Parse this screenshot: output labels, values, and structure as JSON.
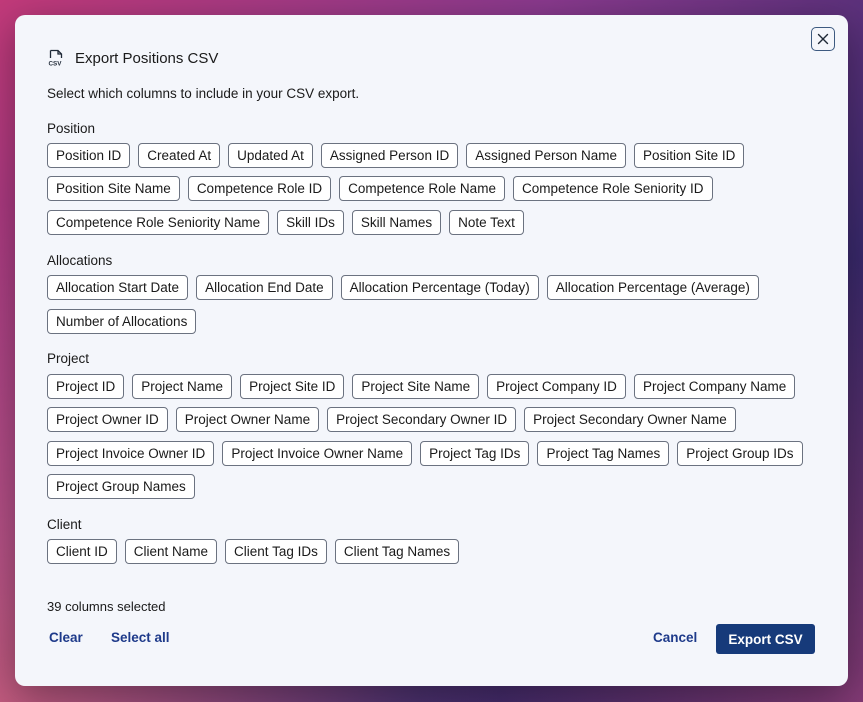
{
  "dialog": {
    "title": "Export Positions CSV",
    "description": "Select which columns to include in your CSV export.",
    "icon": "csv-file-icon",
    "selected_count_text": "39 columns selected",
    "clear_label": "Clear",
    "select_all_label": "Select all",
    "cancel_label": "Cancel",
    "export_label": "Export CSV"
  },
  "sections": [
    {
      "label": "Position",
      "rows": [
        [
          "Position ID",
          "Created At",
          "Updated At",
          "Assigned Person ID",
          "Assigned Person Name",
          "Position Site ID"
        ],
        [
          "Position Site Name",
          "Competence Role ID",
          "Competence Role Name",
          "Competence Role Seniority ID"
        ],
        [
          "Competence Role Seniority Name",
          "Skill IDs",
          "Skill Names",
          "Note Text"
        ]
      ]
    },
    {
      "label": "Allocations",
      "rows": [
        [
          "Allocation Start Date",
          "Allocation End Date",
          "Allocation Percentage (Today)",
          "Allocation Percentage (Average)"
        ],
        [
          "Number of Allocations"
        ]
      ]
    },
    {
      "label": "Project",
      "rows": [
        [
          "Project ID",
          "Project Name",
          "Project Site ID",
          "Project Site Name",
          "Project Company ID",
          "Project Company Name"
        ],
        [
          "Project Owner ID",
          "Project Owner Name",
          "Project Secondary Owner ID",
          "Project Secondary Owner Name"
        ],
        [
          "Project Invoice Owner ID",
          "Project Invoice Owner Name",
          "Project Tag IDs",
          "Project Tag Names",
          "Project Group IDs"
        ],
        [
          "Project Group Names"
        ]
      ]
    },
    {
      "label": "Client",
      "rows": [
        [
          "Client ID",
          "Client Name",
          "Client Tag IDs",
          "Client Tag Names"
        ]
      ]
    }
  ]
}
